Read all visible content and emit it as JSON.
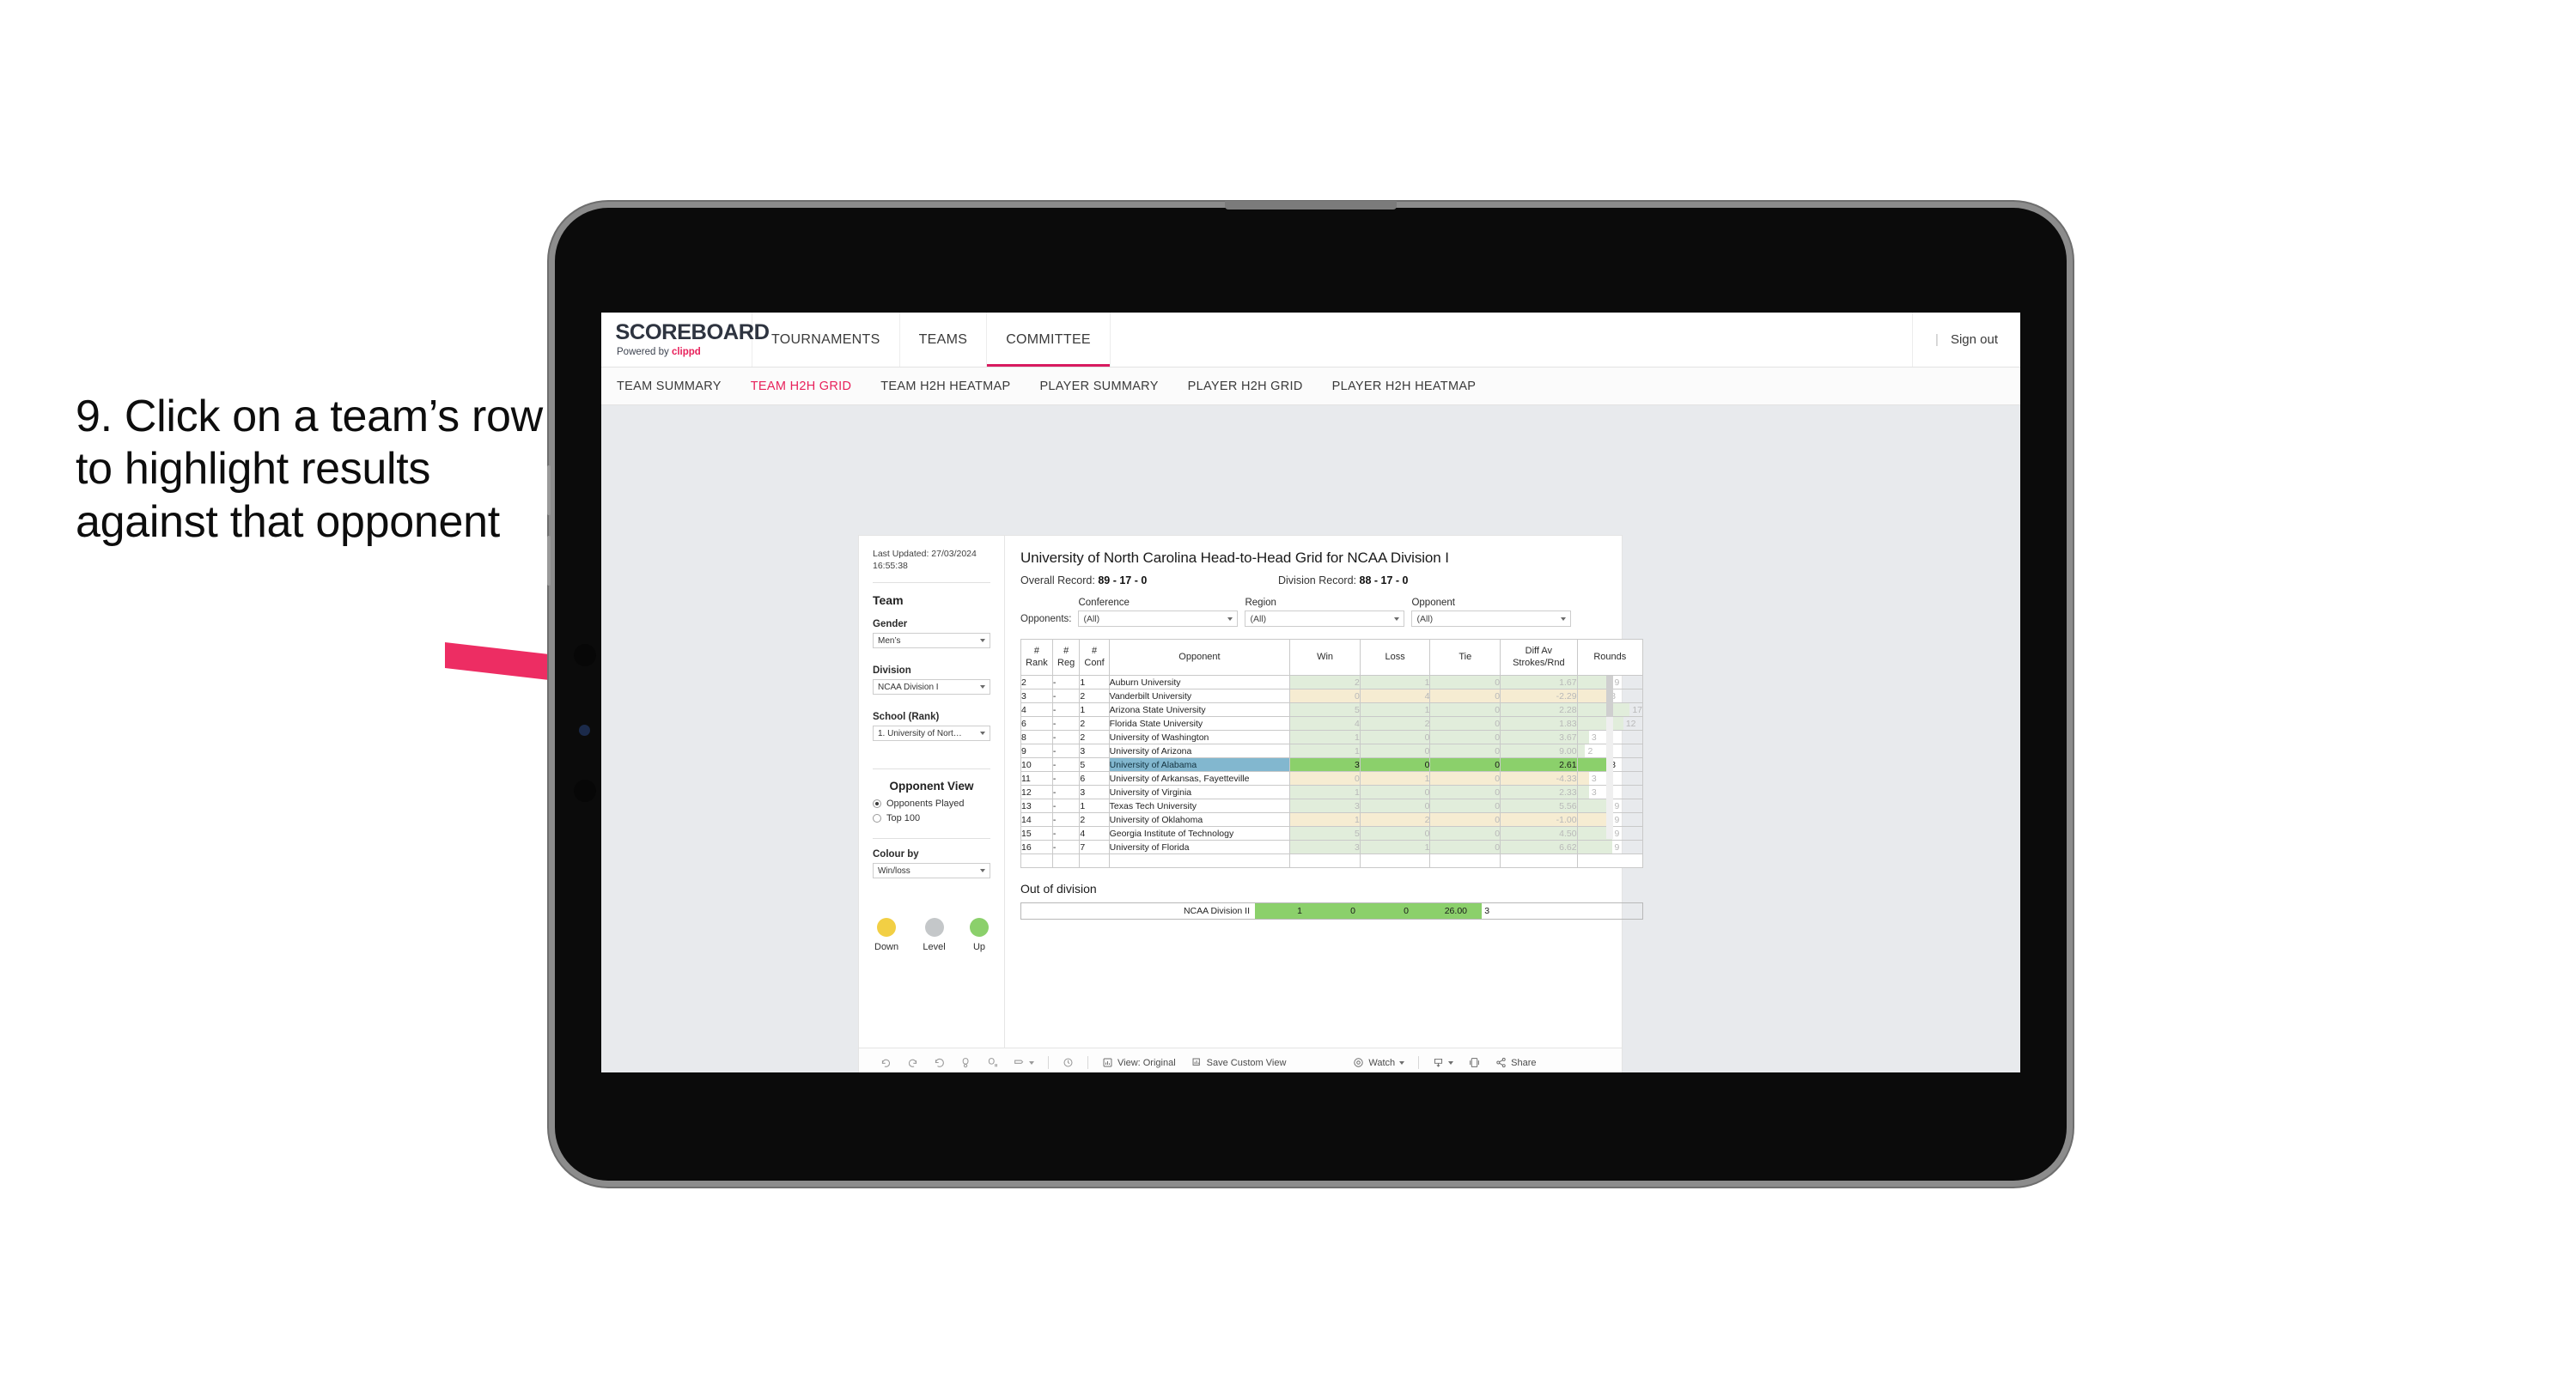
{
  "caption": "9. Click on a team’s row to highlight results against that opponent",
  "topnav": {
    "brand_title": "SCOREBOARD",
    "brand_sub_prefix": "Powered by ",
    "brand_sub_name": "clippd",
    "items": [
      {
        "label": "TOURNAMENTS",
        "active": false
      },
      {
        "label": "TEAMS",
        "active": false
      },
      {
        "label": "COMMITTEE",
        "active": true
      }
    ],
    "separator": "|",
    "signout_label": "Sign out"
  },
  "subnav": {
    "items": [
      {
        "label": "TEAM SUMMARY",
        "active": false
      },
      {
        "label": "TEAM H2H GRID",
        "active": true
      },
      {
        "label": "TEAM H2H HEATMAP",
        "active": false
      },
      {
        "label": "PLAYER SUMMARY",
        "active": false
      },
      {
        "label": "PLAYER H2H GRID",
        "active": false
      },
      {
        "label": "PLAYER H2H HEATMAP",
        "active": false
      }
    ]
  },
  "filters": {
    "last_updated": "Last Updated: 27/03/2024 16:55:38",
    "team_heading": "Team",
    "gender_label": "Gender",
    "gender_value": "Men’s",
    "division_label": "Division",
    "division_value": "NCAA Division I",
    "school_label": "School (Rank)",
    "school_value": "1. University of Nort…",
    "opponent_view_heading": "Opponent View",
    "radio_opponents_played": "Opponents Played",
    "radio_top100": "Top 100",
    "colour_by_label": "Colour by",
    "colour_by_value": "Win/loss",
    "legend": [
      {
        "label": "Down",
        "color": "#f2cf44"
      },
      {
        "label": "Level",
        "color": "#c4c7c9"
      },
      {
        "label": "Up",
        "color": "#8bd06b"
      }
    ]
  },
  "content": {
    "title": "University of North Carolina Head-to-Head Grid for NCAA Division I",
    "overall_record_label": "Overall Record:",
    "overall_record_value": "89 - 17 - 0",
    "division_record_label": "Division Record:",
    "division_record_value": "88 - 17 - 0",
    "opponents_label": "Opponents:",
    "dropdowns": [
      {
        "label": "Conference",
        "value": "(All)"
      },
      {
        "label": "Region",
        "value": "(All)"
      },
      {
        "label": "Opponent",
        "value": "(All)"
      }
    ]
  },
  "chart_data": {
    "type": "table",
    "title": "University of North Carolina Head-to-Head Grid for NCAA Division I",
    "columns": [
      "# Rank",
      "# Reg",
      "# Conf",
      "Opponent",
      "Win",
      "Loss",
      "Tie",
      "Diff Av Strokes/Rnd",
      "Rounds"
    ],
    "column_headers_multiline": [
      [
        "#",
        "Rank"
      ],
      [
        "#",
        "Reg"
      ],
      [
        "#",
        "Conf"
      ],
      [
        "Opponent"
      ],
      [
        "Win"
      ],
      [
        "Loss"
      ],
      [
        "Tie"
      ],
      [
        "Diff Av",
        "Strokes/Rnd"
      ],
      [
        "Rounds"
      ]
    ],
    "rounds_max": 17,
    "rows": [
      {
        "rank": "2",
        "reg": "-",
        "conf": "1",
        "opponent": "Auburn University",
        "win": "2",
        "loss": "1",
        "tie": "0",
        "diff": "1.67",
        "rounds": "9",
        "tone": "up",
        "selected": false
      },
      {
        "rank": "3",
        "reg": "-",
        "conf": "2",
        "opponent": "Vanderbilt University",
        "win": "0",
        "loss": "4",
        "tie": "0",
        "diff": "-2.29",
        "rounds": "8",
        "tone": "down",
        "selected": false
      },
      {
        "rank": "4",
        "reg": "-",
        "conf": "1",
        "opponent": "Arizona State University",
        "win": "5",
        "loss": "1",
        "tie": "0",
        "diff": "2.28",
        "rounds": "17",
        "tone": "up",
        "selected": false
      },
      {
        "rank": "6",
        "reg": "-",
        "conf": "2",
        "opponent": "Florida State University",
        "win": "4",
        "loss": "2",
        "tie": "0",
        "diff": "1.83",
        "rounds": "12",
        "tone": "up",
        "selected": false
      },
      {
        "rank": "8",
        "reg": "-",
        "conf": "2",
        "opponent": "University of Washington",
        "win": "1",
        "loss": "0",
        "tie": "0",
        "diff": "3.67",
        "rounds": "3",
        "tone": "up",
        "selected": false
      },
      {
        "rank": "9",
        "reg": "-",
        "conf": "3",
        "opponent": "University of Arizona",
        "win": "1",
        "loss": "0",
        "tie": "0",
        "diff": "9.00",
        "rounds": "2",
        "tone": "up",
        "selected": false
      },
      {
        "rank": "10",
        "reg": "-",
        "conf": "5",
        "opponent": "University of Alabama",
        "win": "3",
        "loss": "0",
        "tie": "0",
        "diff": "2.61",
        "rounds": "8",
        "tone": "up",
        "selected": true
      },
      {
        "rank": "11",
        "reg": "-",
        "conf": "6",
        "opponent": "University of Arkansas, Fayetteville",
        "win": "0",
        "loss": "1",
        "tie": "0",
        "diff": "-4.33",
        "rounds": "3",
        "tone": "down",
        "selected": false
      },
      {
        "rank": "12",
        "reg": "-",
        "conf": "3",
        "opponent": "University of Virginia",
        "win": "1",
        "loss": "0",
        "tie": "0",
        "diff": "2.33",
        "rounds": "3",
        "tone": "up",
        "selected": false
      },
      {
        "rank": "13",
        "reg": "-",
        "conf": "1",
        "opponent": "Texas Tech University",
        "win": "3",
        "loss": "0",
        "tie": "0",
        "diff": "5.56",
        "rounds": "9",
        "tone": "up",
        "selected": false
      },
      {
        "rank": "14",
        "reg": "-",
        "conf": "2",
        "opponent": "University of Oklahoma",
        "win": "1",
        "loss": "2",
        "tie": "0",
        "diff": "-1.00",
        "rounds": "9",
        "tone": "down",
        "selected": false
      },
      {
        "rank": "15",
        "reg": "-",
        "conf": "4",
        "opponent": "Georgia Institute of Technology",
        "win": "5",
        "loss": "0",
        "tie": "0",
        "diff": "4.50",
        "rounds": "9",
        "tone": "up",
        "selected": false
      },
      {
        "rank": "16",
        "reg": "-",
        "conf": "7",
        "opponent": "University of Florida",
        "win": "3",
        "loss": "1",
        "tie": "0",
        "diff": "6.62",
        "rounds": "9",
        "tone": "up",
        "selected": false
      }
    ]
  },
  "out_of_division": {
    "title": "Out of division",
    "name": "NCAA Division II",
    "win": "1",
    "loss": "0",
    "tie": "0",
    "diff": "26.00",
    "rounds": "3"
  },
  "toolbar": {
    "view_label": "View: Original",
    "save_label": "Save Custom View",
    "watch_label": "Watch",
    "share_label": "Share"
  },
  "colors": {
    "accent": "#e8215b",
    "selected_row": "#82b7cf",
    "green": "#8bd06b",
    "green_faded": "#e1eddb",
    "yellow_faded": "#f6ecd2",
    "arrow": "#ed2d63"
  }
}
